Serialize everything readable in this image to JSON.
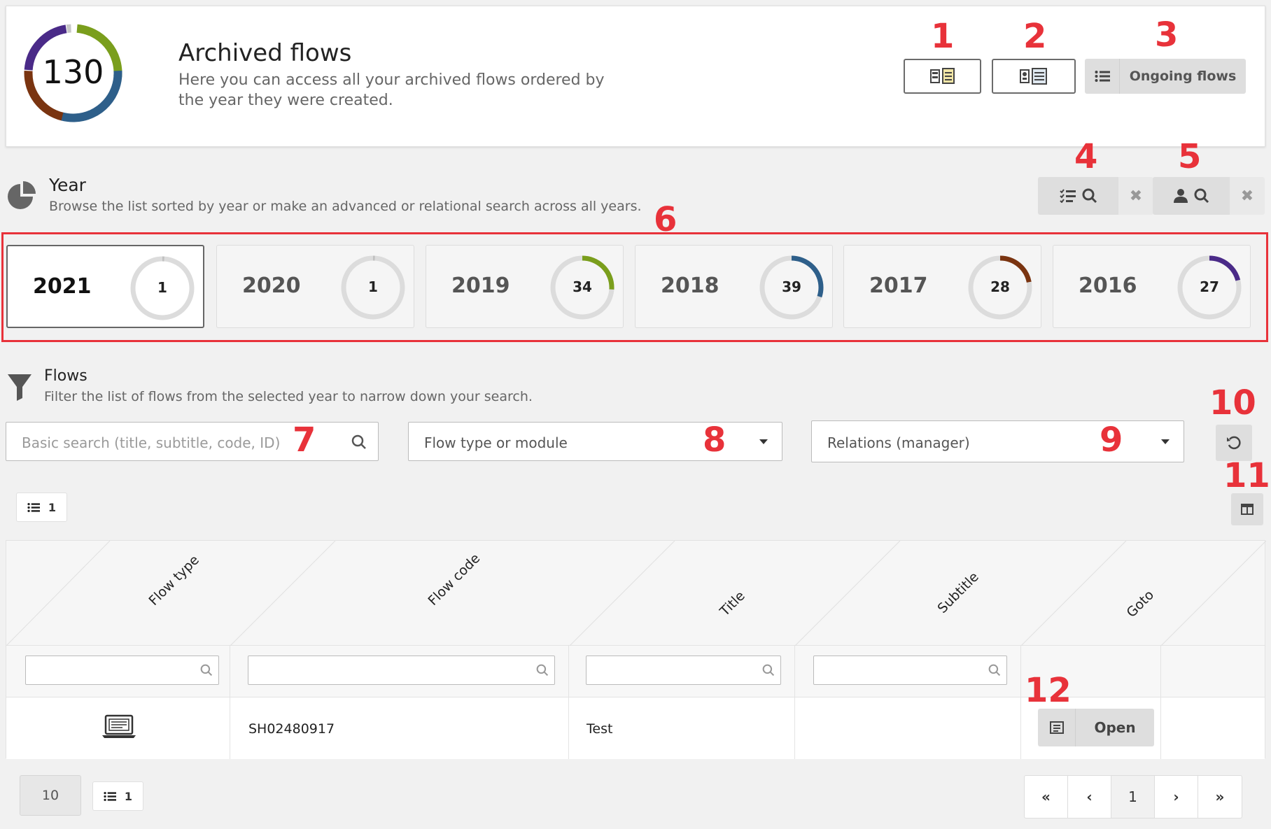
{
  "header": {
    "total": "130",
    "title": "Archived flows",
    "subtitle": "Here you can access all your archived flows ordered by the year they were created.",
    "ongoing_label": "Ongoing flows"
  },
  "year_section": {
    "title": "Year",
    "subtitle": "Browse the list sorted by year or make an advanced or relational search across all years."
  },
  "years": [
    {
      "year": "2021",
      "count": "1",
      "fraction": 0.01,
      "color": "#c0c0c0"
    },
    {
      "year": "2020",
      "count": "1",
      "fraction": 0.01,
      "color": "#c0c0c0"
    },
    {
      "year": "2019",
      "count": "34",
      "fraction": 0.26,
      "color": "#7a9e1c"
    },
    {
      "year": "2018",
      "count": "39",
      "fraction": 0.3,
      "color": "#2e5f8a"
    },
    {
      "year": "2017",
      "count": "28",
      "fraction": 0.22,
      "color": "#7a3410"
    },
    {
      "year": "2016",
      "count": "27",
      "fraction": 0.21,
      "color": "#4a2a88"
    }
  ],
  "flows_section": {
    "title": "Flows",
    "subtitle": "Filter the list of flows from the selected year to narrow down your search.",
    "search_placeholder": "Basic search (title, subtitle, code, ID)",
    "flow_type_placeholder": "Flow type or module",
    "relations_placeholder": "Relations (manager)",
    "list_count": "1"
  },
  "table": {
    "headers": [
      "Flow type",
      "Flow code",
      "Title",
      "Subtitle",
      "Goto"
    ],
    "rows": [
      {
        "flow_type_icon": "laptop-icon",
        "flow_code": "SH02480917",
        "title": "Test",
        "subtitle": "",
        "goto_label": "Open"
      }
    ]
  },
  "footer": {
    "page_size": "10",
    "list_count": "1",
    "pages": [
      "1"
    ],
    "current_page": "1"
  },
  "annotations": [
    "1",
    "2",
    "3",
    "4",
    "5",
    "6",
    "7",
    "8",
    "9",
    "10",
    "11",
    "12"
  ],
  "colors": {
    "accent_red": "#e8323a",
    "ring_green": "#7a9e1c",
    "ring_blue": "#2e5f8a",
    "ring_brown": "#7a3410",
    "ring_purple": "#4a2a88"
  }
}
